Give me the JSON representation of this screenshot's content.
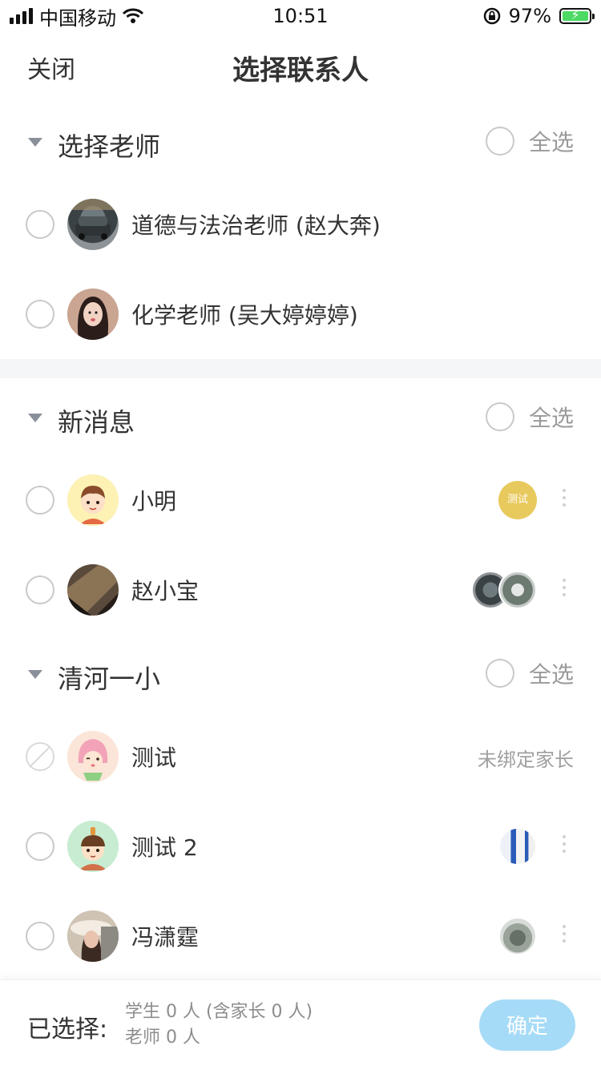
{
  "status_bar": {
    "carrier": "中国移动",
    "time": "10:51",
    "battery": "97%"
  },
  "nav": {
    "close_label": "关闭",
    "title": "选择联系人"
  },
  "sections": [
    {
      "title": "选择老师",
      "select_all": "全选",
      "rows": [
        {
          "name": "道德与法治老师 (赵大奔)"
        },
        {
          "name": "化学老师 (吴大婷婷婷)"
        }
      ]
    },
    {
      "title": "新消息",
      "select_all": "全选",
      "rows": [
        {
          "name": "小明",
          "tag": "测试"
        },
        {
          "name": "赵小宝"
        }
      ]
    },
    {
      "title": "清河一小",
      "select_all": "全选",
      "rows": [
        {
          "name": "测试",
          "status": "未绑定家长"
        },
        {
          "name": "测试 2"
        },
        {
          "name": "冯潇霆"
        }
      ]
    }
  ],
  "bottom_bar": {
    "selected_label": "已选择:",
    "students_line": "学生 0 人 (含家长 0 人)",
    "teachers_line": "老师 0 人",
    "confirm_label": "确定"
  },
  "colors": {
    "accent_disabled": "#a6dbf7",
    "tag_yellow": "#e8c95d",
    "battery_green": "#4cd964"
  }
}
